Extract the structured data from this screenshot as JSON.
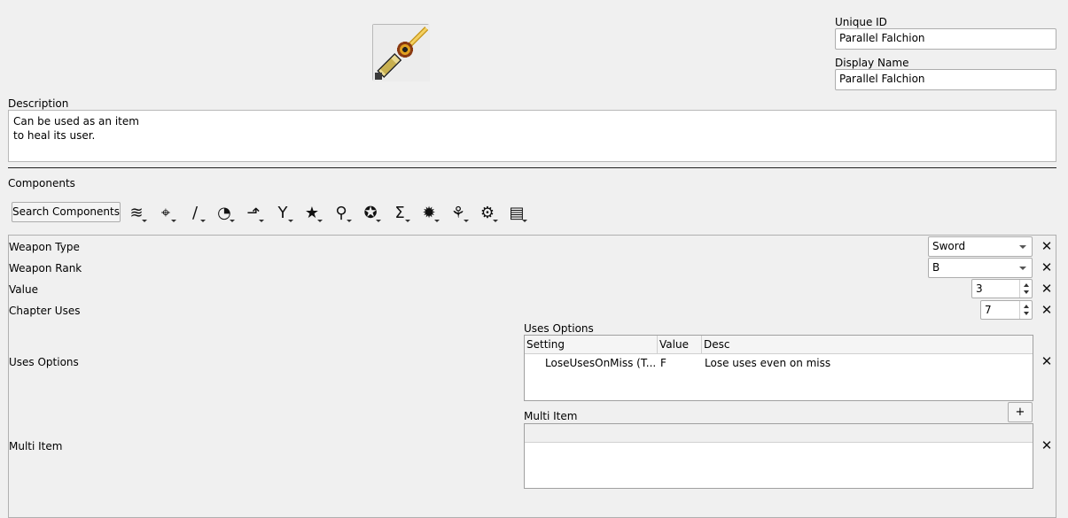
{
  "item": {
    "icon_name": "sword-icon",
    "unique_id_label": "Unique ID",
    "unique_id": "Parallel Falchion",
    "display_name_label": "Display Name",
    "display_name": "Parallel Falchion",
    "description_label": "Description",
    "description": "Can be used as an item\nto heal its user."
  },
  "components": {
    "label": "Components",
    "search_button": "Search Components",
    "toolbar": [
      {
        "name": "layers-icon",
        "glyph": "≋"
      },
      {
        "name": "target-icon",
        "glyph": "⌖"
      },
      {
        "name": "blade-icon",
        "glyph": "/"
      },
      {
        "name": "clock-icon",
        "glyph": "◔"
      },
      {
        "name": "arrow-up-icon",
        "glyph": "⬏"
      },
      {
        "name": "fork-icon",
        "glyph": "Y"
      },
      {
        "name": "star-icon",
        "glyph": "★"
      },
      {
        "name": "staff-icon",
        "glyph": "⚲"
      },
      {
        "name": "badge-icon",
        "glyph": "✪"
      },
      {
        "name": "sigma-icon",
        "glyph": "Σ"
      },
      {
        "name": "burst-icon",
        "glyph": "✹"
      },
      {
        "name": "palette-icon",
        "glyph": "⚘"
      },
      {
        "name": "gear-icon",
        "glyph": "⚙"
      },
      {
        "name": "layout-icon",
        "glyph": "▤"
      }
    ]
  },
  "rows": {
    "weapon_type": {
      "label": "Weapon Type",
      "value": "Sword"
    },
    "weapon_rank": {
      "label": "Weapon Rank",
      "value": "B"
    },
    "value": {
      "label": "Value",
      "value": "3"
    },
    "chapter_uses": {
      "label": "Chapter Uses",
      "value": "7"
    },
    "uses_options": {
      "label": "Uses Options",
      "table_title": "Uses Options",
      "headers": [
        "Setting",
        "Value",
        "Desc"
      ],
      "rows": [
        {
          "setting": "LoseUsesOnMiss (T...",
          "value": "F",
          "desc": "Lose uses even on miss"
        }
      ]
    },
    "multi_item": {
      "label": "Multi Item",
      "table_title": "Multi Item",
      "add_button": "+"
    }
  },
  "remove_glyph": "✕"
}
